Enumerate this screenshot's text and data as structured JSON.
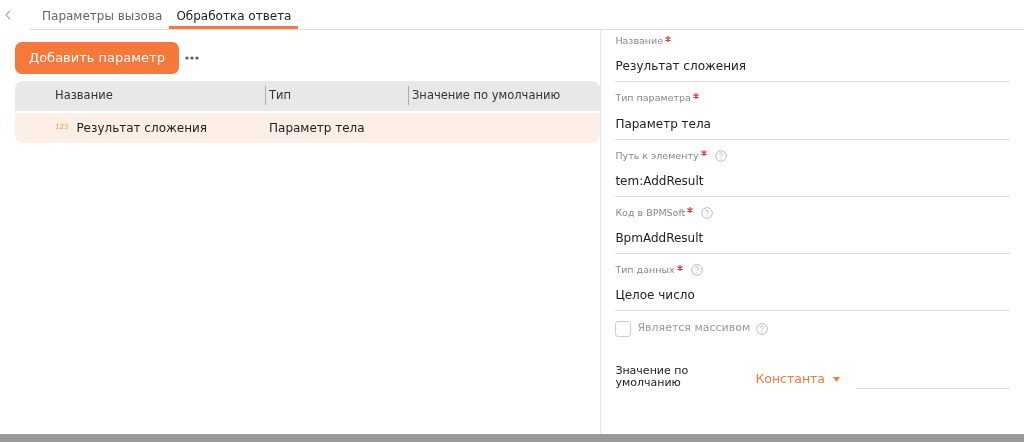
{
  "tabs": [
    {
      "label": "Параметры вызова",
      "selected": false
    },
    {
      "label": "Обработка ответа",
      "selected": true
    }
  ],
  "add_button": "Добавить параметр",
  "table": {
    "columns": [
      "Название",
      "Тип",
      "Значение по умолчанию"
    ],
    "rows": [
      {
        "type_badge": "123",
        "cells": [
          "Результат сложения",
          "Параметр тела",
          ""
        ],
        "selected": true
      }
    ]
  },
  "form": {
    "fields": [
      {
        "label": "Название",
        "required": true,
        "help": false,
        "value": "Результат сложения"
      },
      {
        "label": "Тип параметра",
        "required": true,
        "help": false,
        "value": "Параметр тела"
      },
      {
        "label": "Путь к элементу",
        "required": true,
        "help": true,
        "value": "tem:AddResult"
      },
      {
        "label": "Код в BPMSoft",
        "required": true,
        "help": true,
        "value": "BpmAddResult"
      },
      {
        "label": "Тип данных",
        "required": true,
        "help": true,
        "value": "Целое число"
      }
    ],
    "checkbox": {
      "label": "Является массивом",
      "checked": false,
      "help": true
    },
    "default_value": {
      "label": "Значение по умолчанию",
      "mode": "Константа"
    }
  }
}
